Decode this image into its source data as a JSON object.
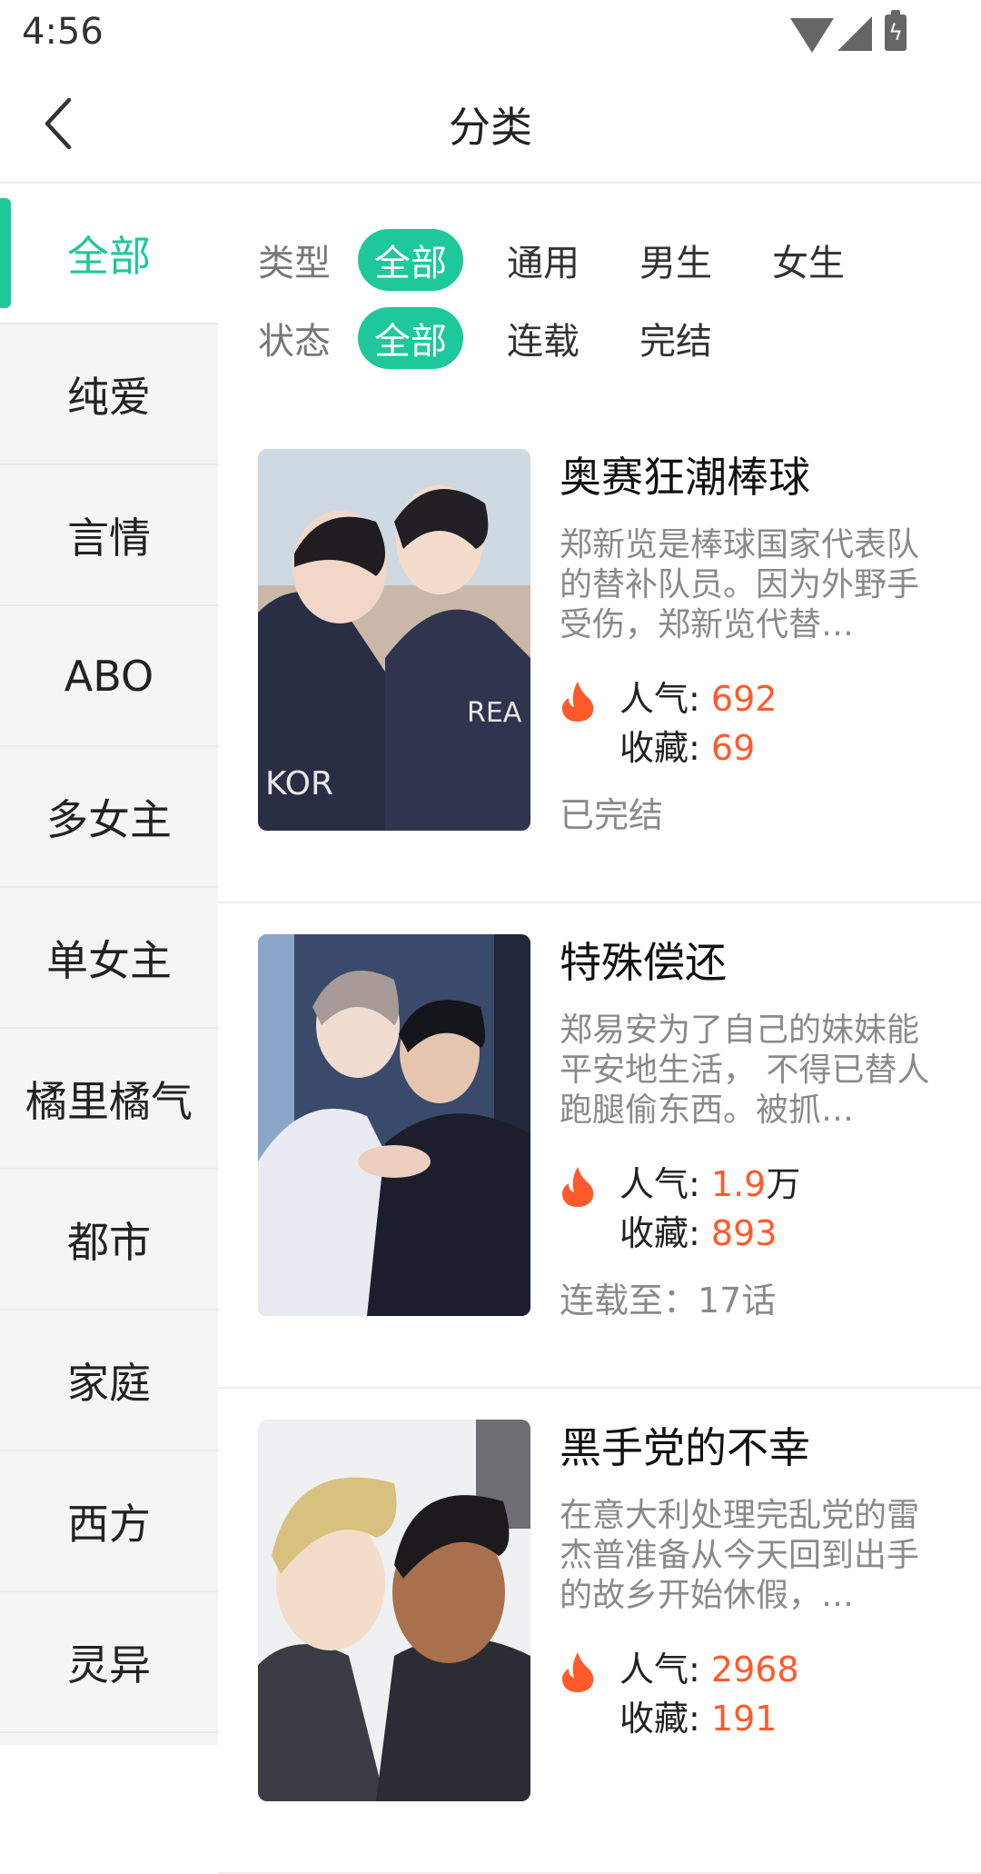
{
  "statusbar": {
    "time": "4:56"
  },
  "header": {
    "title": "分类"
  },
  "sidebar": {
    "items": [
      {
        "label": "全部",
        "active": true
      },
      {
        "label": "纯爱"
      },
      {
        "label": "言情"
      },
      {
        "label": "ABO"
      },
      {
        "label": "多女主"
      },
      {
        "label": "单女主"
      },
      {
        "label": "橘里橘气"
      },
      {
        "label": "都市"
      },
      {
        "label": "家庭"
      },
      {
        "label": "西方"
      },
      {
        "label": "灵异"
      }
    ]
  },
  "filters": {
    "type": {
      "label": "类型",
      "options": [
        "全部",
        "通用",
        "男生",
        "女生"
      ],
      "selected": "全部"
    },
    "status": {
      "label": "状态",
      "options": [
        "全部",
        "连载",
        "完结"
      ],
      "selected": "全部"
    }
  },
  "books": [
    {
      "title": "奥赛狂潮棒球",
      "description": "郑新览是棒球国家代表队的替补队员。因为外野手受伤，郑新览代替…",
      "popularity_label": "人气: ",
      "popularity": "692",
      "popularity_unit": "",
      "favorites_label": "收藏: ",
      "favorites": "69",
      "status": "已完结"
    },
    {
      "title": "特殊偿还",
      "description": "郑易安为了自己的妹妹能平安地生活， 不得已替人跑腿偷东西。被抓…",
      "popularity_label": "人气: ",
      "popularity": "1.9",
      "popularity_unit": "万",
      "favorites_label": "收藏: ",
      "favorites": "893",
      "status": "连载至：17话"
    },
    {
      "title": "黑手党的不幸",
      "description": "在意大利处理完乱党的雷杰普准备从今天回到出手的故乡开始休假，…",
      "popularity_label": "人气: ",
      "popularity": "2968",
      "popularity_unit": "",
      "favorites_label": "收藏: ",
      "favorites": "191",
      "status": ""
    }
  ],
  "colors": {
    "accent": "#1ec89a",
    "hot": "#ff5a2c"
  }
}
